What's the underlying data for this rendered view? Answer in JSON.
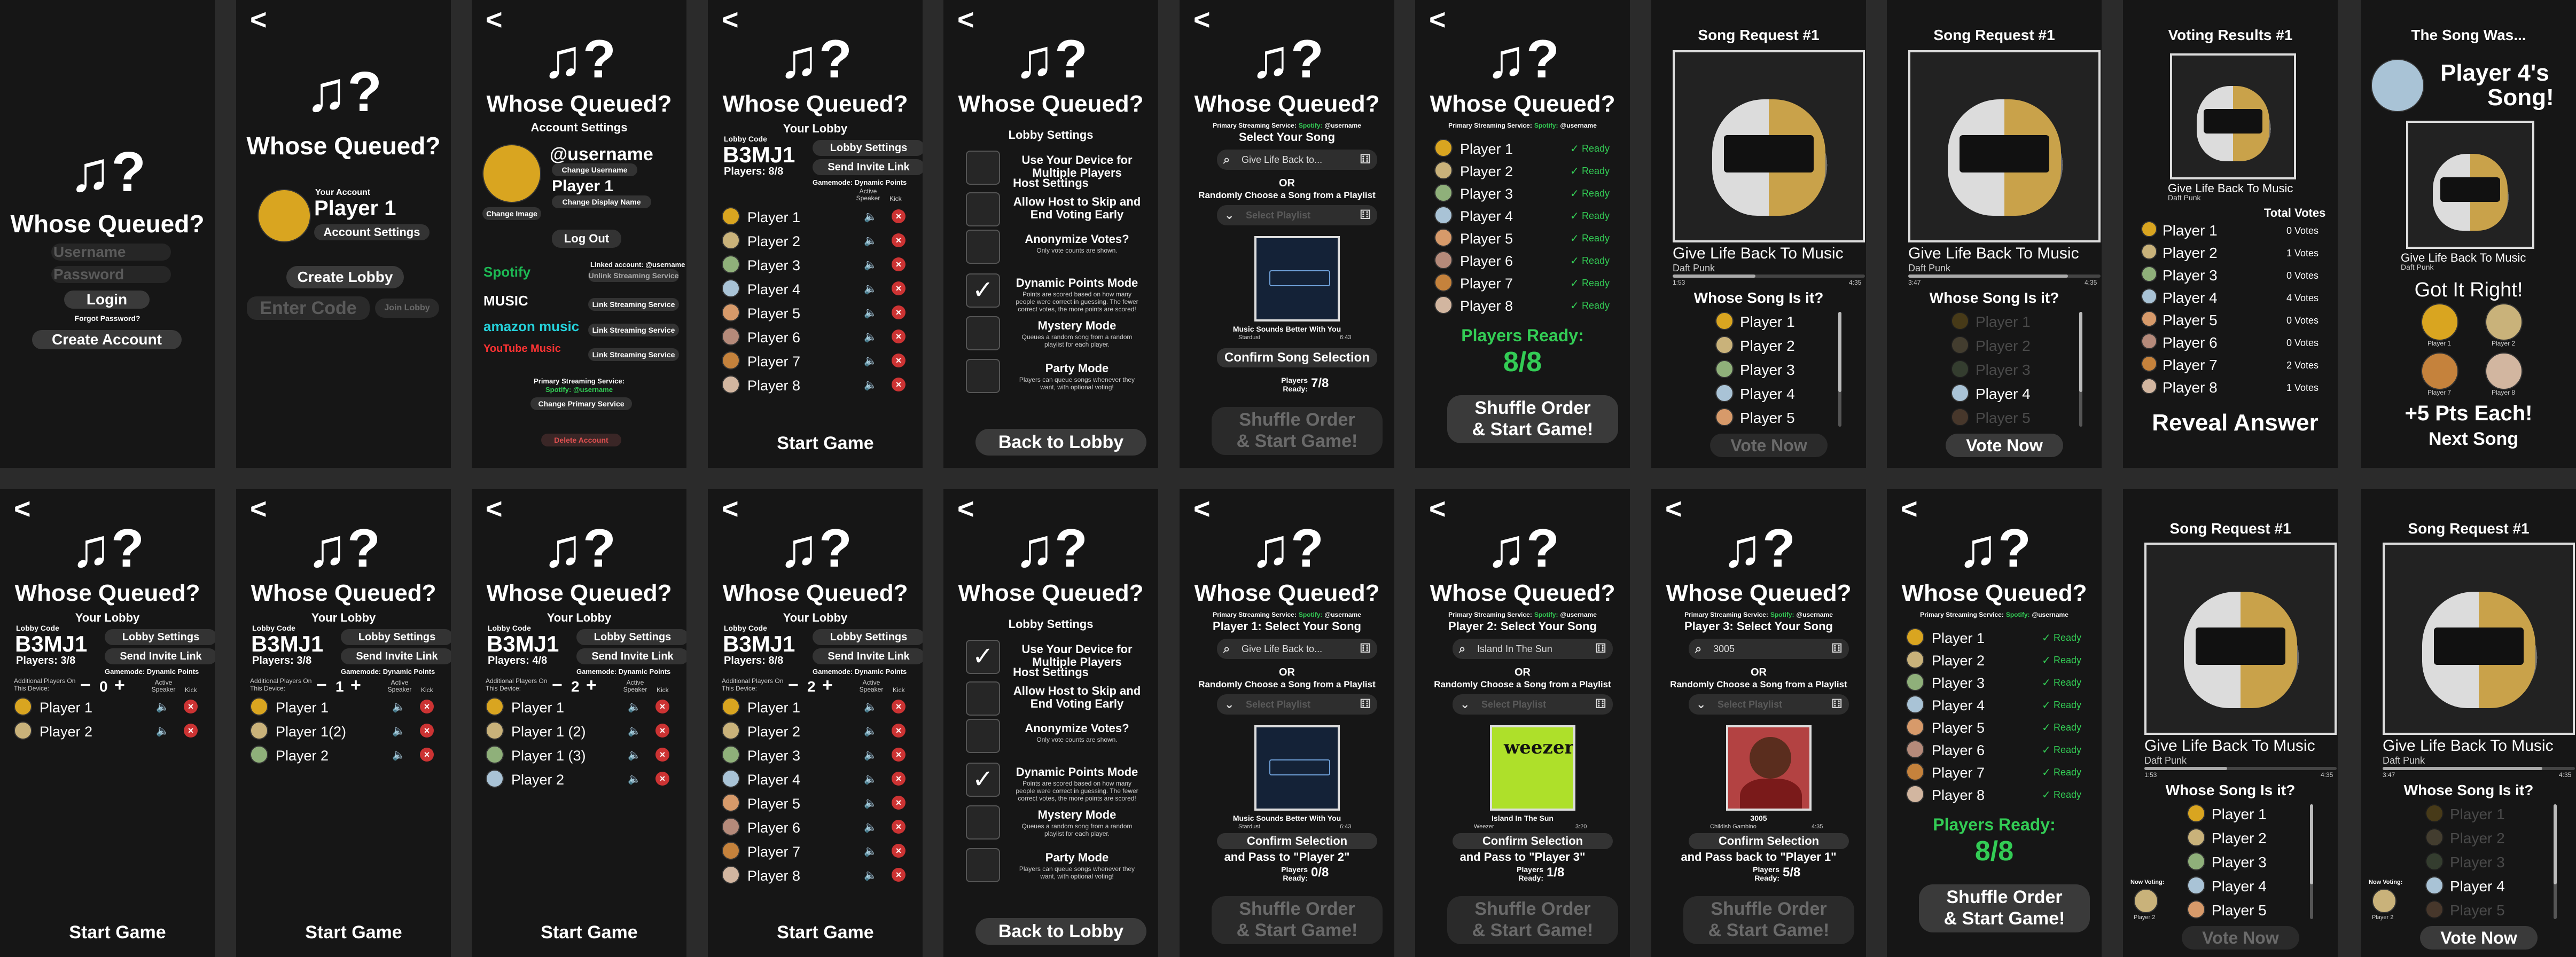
{
  "common": {
    "back": "<",
    "logo": "♫?",
    "app_name": "Whose Queued?",
    "start_game": "Start Game",
    "back_to_lobby": "Back to Lobby",
    "shuffle_line1": "Shuffle Order",
    "shuffle_line2": "& Start Game!",
    "your_lobby": "Your Lobby",
    "lobby_code_label": "Lobby Code",
    "lobby_code": "B3MJ1",
    "lobby_settings": "Lobby Settings",
    "send_invite": "Send Invite Link",
    "gamemode": "Gamemode: Dynamic Points",
    "active_speaker": "Active Speaker",
    "kick": "Kick",
    "additional_players": "Additional Players On This Device:",
    "primary_service": "Primary Streaming Service:",
    "spotify": "Spotify:",
    "username_handle": "@username",
    "or": "OR",
    "random_playlist": "Randomly Choose a Song from a Playlist",
    "select_playlist": "Select Playlist",
    "ready": "Ready",
    "players_ready_label": "Players Ready:",
    "whose_song": "Whose Song Is it?",
    "vote_now": "Vote Now",
    "song_request": "Song Request #1",
    "song_title": "Give Life Back To Music",
    "song_artist": "Daft Punk",
    "time_start": "1:53",
    "time_start2": "3:47",
    "time_end": "4:35",
    "now_voting": "Now Voting:"
  },
  "s1": {
    "username_ph": "Username",
    "password_ph": "Password",
    "login": "Login",
    "forgot": "Forgot Password?",
    "create": "Create Account"
  },
  "s2": {
    "your_account": "Your Account",
    "player": "Player 1",
    "account_settings": "Account Settings",
    "create_lobby": "Create Lobby",
    "enter_code": "Enter Code",
    "join_lobby": "Join Lobby"
  },
  "s3": {
    "account_settings": "Account Settings",
    "username": "@username",
    "change_username": "Change Username",
    "player": "Player 1",
    "change_display": "Change Display Name",
    "change_image": "Change Image",
    "log_out": "Log Out",
    "services": [
      {
        "name": "Spotify",
        "linked": "Linked account: @username",
        "action": "Unlink Streaming Service"
      },
      {
        "name": "MUSIC",
        "linked": "",
        "action": "Link Streaming Service"
      },
      {
        "name": "amazon music",
        "linked": "",
        "action": "Link Streaming Service"
      },
      {
        "name": "YouTube Music",
        "linked": "",
        "action": "Link Streaming Service"
      }
    ],
    "primary": "Primary Streaming Service:",
    "primary_value": "Spotify: @username",
    "change_primary": "Change Primary Service",
    "delete": "Delete Account"
  },
  "s4": {
    "players_count": "Players: 8/8",
    "players": [
      "Player 1",
      "Player 2",
      "Player 3",
      "Player 4",
      "Player 5",
      "Player 6",
      "Player 7",
      "Player 8"
    ]
  },
  "s5": {
    "title": "Lobby Settings",
    "options": [
      {
        "label": "Use Your Device for Multiple Players",
        "desc": "",
        "checked": false
      },
      {
        "label": "Allow Host to Skip and End Voting Early",
        "desc": "",
        "checked": false
      },
      {
        "label": "Anonymize Votes?",
        "desc": "Only vote counts are shown.",
        "checked": false
      },
      {
        "label": "Dynamic Points Mode",
        "desc": "Points are scored based on how many people were correct in guessing. The fewer correct votes, the more points are scored!",
        "checked": true
      },
      {
        "label": "Mystery Mode",
        "desc": "Queues a random song from a random playlist for each player.",
        "checked": false
      },
      {
        "label": "Party Mode",
        "desc": "Players can queue songs whenever they want, with optional voting!",
        "checked": false
      }
    ],
    "host_settings": "Host Settings"
  },
  "s6": {
    "select_song": "Select Your Song",
    "search_value": "Give Life Back to...",
    "card_caption": "Music Sounds Better With You",
    "card_artist": "Stardust",
    "card_time": "6:43",
    "confirm": "Confirm Song Selection",
    "players_ready": "Players Ready:",
    "ready_count": "7/8"
  },
  "s7": {
    "ready_count": "8/8",
    "players": [
      "Player 1",
      "Player 2",
      "Player 3",
      "Player 4",
      "Player 5",
      "Player 6",
      "Player 7",
      "Player 8"
    ]
  },
  "s8": {
    "candidates": [
      "Player 1",
      "Player 2",
      "Player 3",
      "Player 4",
      "Player 5"
    ]
  },
  "s9": {
    "candidates": [
      "Player 1",
      "Player 2",
      "Player 3",
      "Player 4",
      "Player 5"
    ]
  },
  "s10": {
    "title": "Voting Results #1",
    "song": "Give Life Back To Music",
    "artist": "Daft Punk",
    "total_votes": "Total Votes",
    "rows": [
      {
        "name": "Player 1",
        "votes": "0 Votes"
      },
      {
        "name": "Player 2",
        "votes": "1 Votes"
      },
      {
        "name": "Player 3",
        "votes": "0 Votes"
      },
      {
        "name": "Player 4",
        "votes": "4 Votes"
      },
      {
        "name": "Player 5",
        "votes": "0 Votes"
      },
      {
        "name": "Player 6",
        "votes": "0 Votes"
      },
      {
        "name": "Player 7",
        "votes": "2 Votes"
      },
      {
        "name": "Player 8",
        "votes": "1 Votes"
      }
    ],
    "reveal": "Reveal Answer"
  },
  "s11": {
    "title": "The Song Was...",
    "owner_line1": "Player 4's",
    "owner_line2": "Song!",
    "song": "Give Life Back To Music",
    "artist": "Daft Punk",
    "got_it": "Got It Right!",
    "p1": "Player 1",
    "p2": "Player 2",
    "p7": "Player 7",
    "p8": "Player 8",
    "points": "+5 Pts Each!",
    "next": "Next Song"
  },
  "r1": {
    "players_count": "Players: 3/8",
    "stepper": "0",
    "players": [
      "Player 1",
      "Player 2"
    ]
  },
  "r2": {
    "players_count": "Players: 3/8",
    "stepper": "1",
    "players": [
      "Player 1",
      "Player 1(2)",
      "Player 2"
    ]
  },
  "r3": {
    "players_count": "Players: 4/8",
    "stepper": "2",
    "players": [
      "Player 1",
      "Player 1 (2)",
      "Player 1 (3)",
      "Player 2"
    ]
  },
  "r4": {
    "players_count": "Players: 8/8",
    "stepper": "2",
    "players": [
      "Player 1",
      "Player 2",
      "Player 3",
      "Player 4",
      "Player 5",
      "Player 6",
      "Player 7",
      "Player 8"
    ]
  },
  "r6": {
    "select_song": "Player 1: Select Your Song",
    "search_value": "Give Life Back to...",
    "card_caption": "Music Sounds Better With You",
    "card_artist": "Stardust",
    "card_time": "6:43",
    "confirm1": "Confirm Selection",
    "confirm2": "and Pass to \"Player 2\"",
    "ready_count": "0/8"
  },
  "r7": {
    "select_song": "Player 2: Select Your Song",
    "search_value": "Island In The Sun",
    "card_caption": "Island In The Sun",
    "card_artist": "Weezer",
    "card_time": "3:20",
    "album_text": "weezer",
    "confirm1": "Confirm Selection",
    "confirm2": "and Pass to \"Player 3\"",
    "ready_count": "1/8"
  },
  "r8": {
    "select_song": "Player 3: Select Your Song",
    "search_value": "3005",
    "card_caption": "3005",
    "card_artist": "Childish Gambino",
    "card_time": "4:35",
    "confirm1": "Confirm Selection",
    "confirm2": "and Pass back to \"Player 1\"",
    "ready_count": "5/8"
  },
  "r9": {
    "ready_count": "8/8",
    "players": [
      "Player 1",
      "Player 2",
      "Player 3",
      "Player 4",
      "Player 5",
      "Player 6",
      "Player 7",
      "Player 8"
    ]
  },
  "r10": {
    "candidates": [
      "Player 1",
      "Player 2",
      "Player 3",
      "Player 4",
      "Player 5"
    ],
    "voter": "Player 2"
  },
  "r11": {
    "candidates": [
      "Player 1",
      "Player 2",
      "Player 3",
      "Player 4",
      "Player 5"
    ],
    "voter": "Player 2"
  },
  "colors": {
    "bg": "#161616",
    "ready_green": "#33cc55",
    "kick_red": "#cc3333"
  }
}
